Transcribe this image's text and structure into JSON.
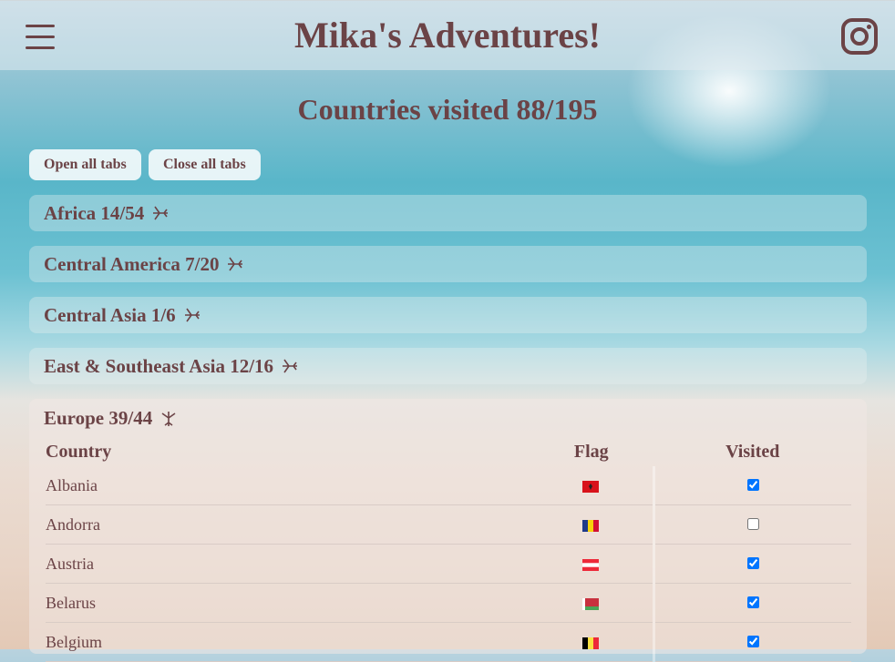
{
  "header": {
    "title": "Mika's Adventures!"
  },
  "page": {
    "title": "Countries visited 88/195"
  },
  "buttons": {
    "open_all": "Open all tabs",
    "close_all": "Close all tabs"
  },
  "regions": [
    {
      "label": "Africa 14/54",
      "expanded": false
    },
    {
      "label": "Central America 7/20",
      "expanded": false
    },
    {
      "label": "Central Asia 1/6",
      "expanded": false
    },
    {
      "label": "East & Southeast Asia 12/16",
      "expanded": false
    },
    {
      "label": "Europe 39/44",
      "expanded": true
    }
  ],
  "table": {
    "headers": {
      "country": "Country",
      "flag": "Flag",
      "visited": "Visited"
    },
    "rows": [
      {
        "country": "Albania",
        "flag": "flag-albania",
        "visited": true
      },
      {
        "country": "Andorra",
        "flag": "flag-andorra",
        "visited": false
      },
      {
        "country": "Austria",
        "flag": "flag-austria",
        "visited": true
      },
      {
        "country": "Belarus",
        "flag": "flag-belarus",
        "visited": true
      },
      {
        "country": "Belgium",
        "flag": "flag-belgium",
        "visited": true
      }
    ]
  },
  "colors": {
    "text": "#6b4346",
    "accent_checkbox": "#1a73e8"
  }
}
